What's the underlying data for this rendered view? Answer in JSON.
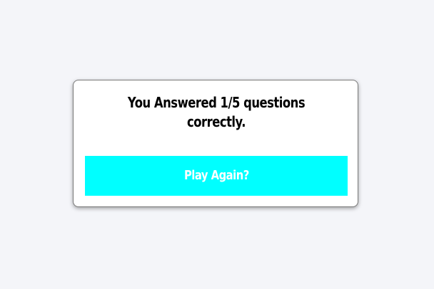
{
  "result": {
    "message": "You Answered 1/5 questions correctly."
  },
  "actions": {
    "play_again_label": "Play Again?"
  },
  "colors": {
    "page_background": "#f4f5f9",
    "card_background": "#ffffff",
    "button_background": "#00ffff",
    "button_text": "#ffffff",
    "message_text": "#000000"
  }
}
